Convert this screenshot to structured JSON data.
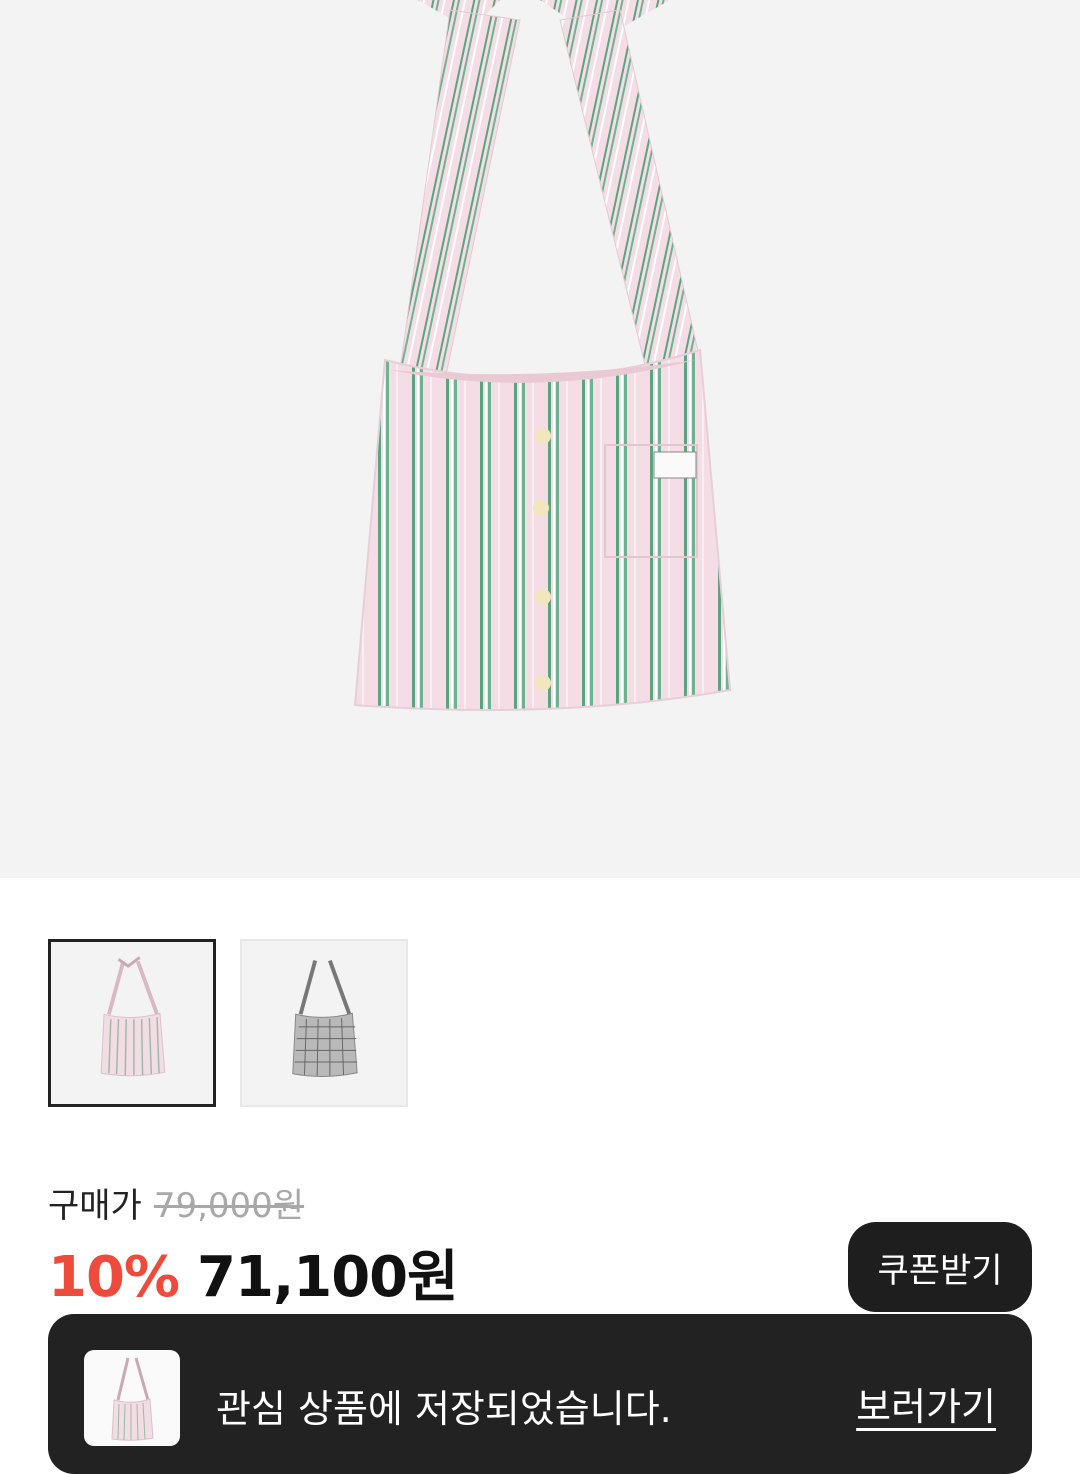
{
  "product": {
    "images": [
      {
        "id": "pink-stripe",
        "selected": true
      },
      {
        "id": "gray-check",
        "selected": false
      }
    ]
  },
  "price": {
    "label": "구매가",
    "original": "79,000원",
    "discount": "10%",
    "sale": "71,100원"
  },
  "coupon": {
    "label": "쿠폰받기"
  },
  "toast": {
    "message": "관심 상품에 저장되었습니다.",
    "action": "보러가기"
  },
  "colors": {
    "discount": "#ef4b3c",
    "dark": "#222222",
    "pink": "#f3d9e2",
    "green": "#5fa985"
  }
}
